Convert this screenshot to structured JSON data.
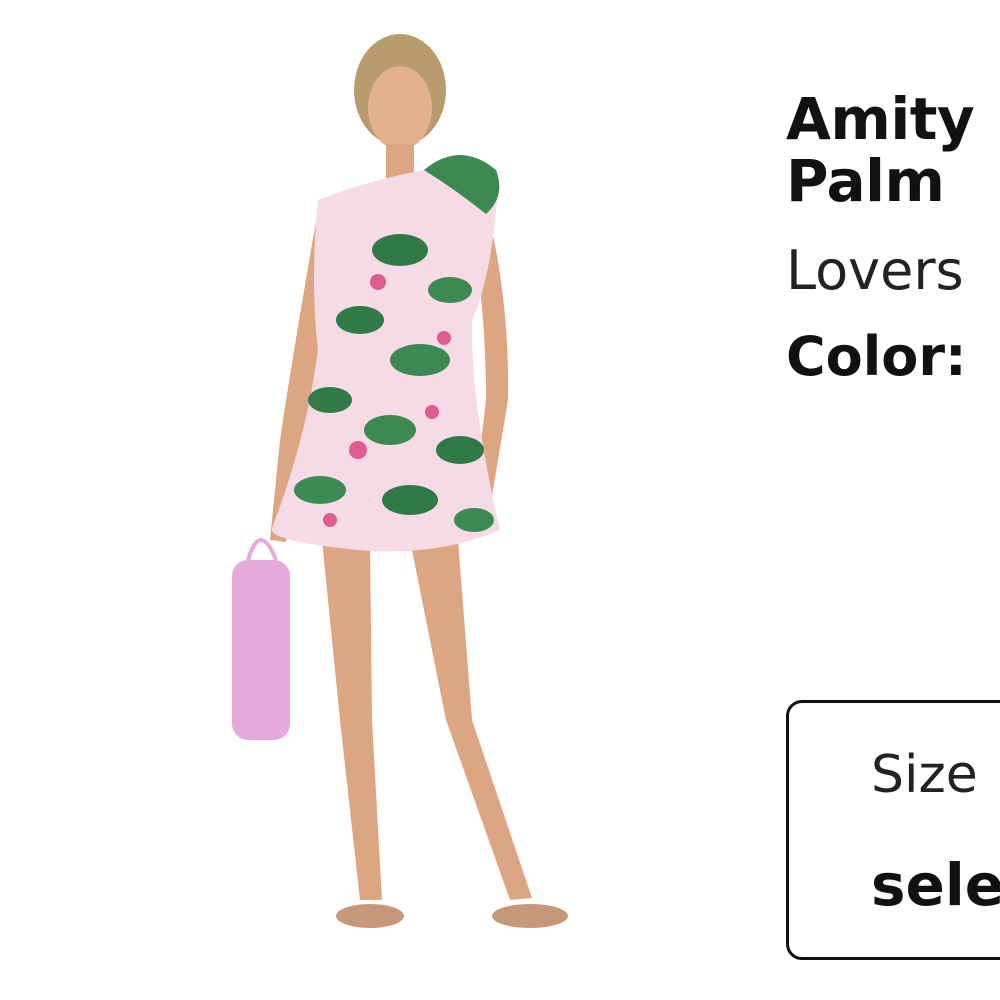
{
  "product": {
    "name": "Amity\nPalm",
    "brand": "Lovers",
    "color_label": "Color:",
    "color_value": ""
  },
  "size_selector": {
    "label": "Size",
    "value": "sele"
  },
  "image": {
    "icon": "product-photo"
  }
}
